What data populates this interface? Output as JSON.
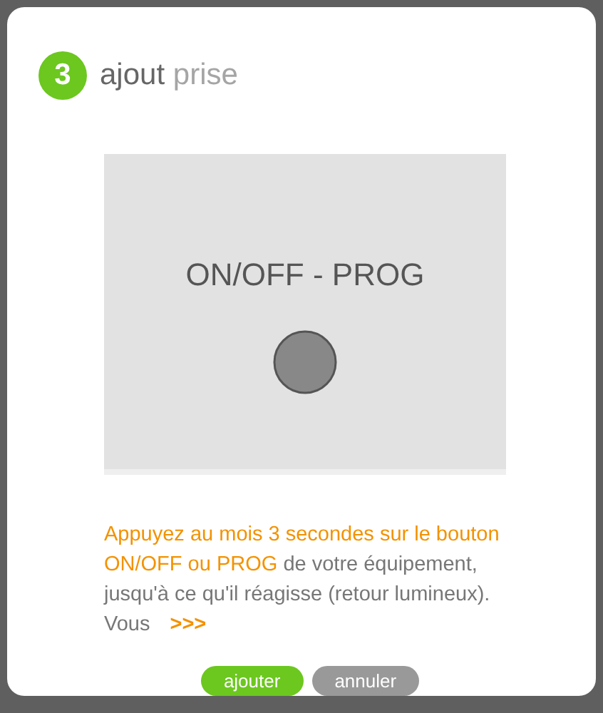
{
  "step": {
    "number": "3",
    "title": "ajout",
    "subtitle": "prise"
  },
  "device_image": {
    "label": "ON/OFF - PROG"
  },
  "instruction": {
    "highlight": "Appuyez au mois 3 secondes sur le bouton ON/OFF ou PROG",
    "text": " de votre équipement, jusqu'à ce qu'il réagisse (retour lumineux). Vous"
  },
  "more_link": ">>>",
  "buttons": [
    {
      "label": "ajouter",
      "kind": "primary"
    },
    {
      "label": "annuler",
      "kind": "secondary"
    }
  ]
}
